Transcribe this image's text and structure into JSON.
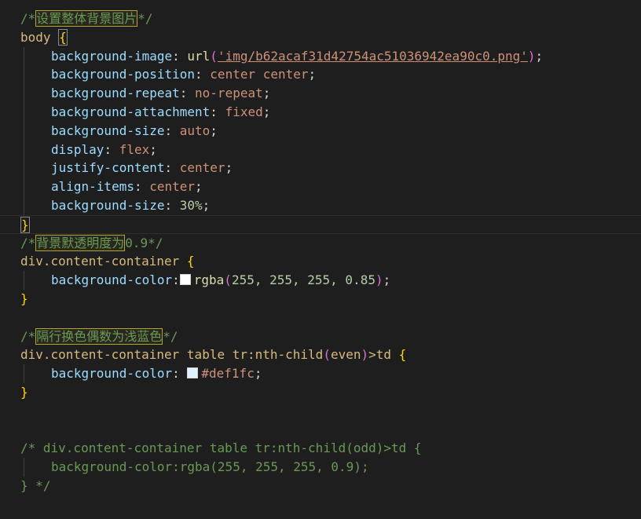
{
  "code": {
    "c1": {
      "open": "/*",
      "text": "设置整体背景图片",
      "close": "*/"
    },
    "body_sel": "body",
    "ob": "{",
    "cb": "}",
    "semi": ";",
    "colon": ": ",
    "colon_nospace": ":",
    "bg_image": {
      "prop": "background-image",
      "fn": "url",
      "lp": "(",
      "str": "'img/b62acaf31d42754ac51036942ea90c0.png'",
      "rp": ")"
    },
    "bg_position": {
      "prop": "background-position",
      "val": "center center"
    },
    "bg_repeat": {
      "prop": "background-repeat",
      "val": "no-repeat"
    },
    "bg_attach": {
      "prop": "background-attachment",
      "val": "fixed"
    },
    "bg_size1": {
      "prop": "background-size",
      "val": "auto"
    },
    "display": {
      "prop": "display",
      "val": "flex"
    },
    "justify": {
      "prop": "justify-content",
      "val": "center"
    },
    "align": {
      "prop": "align-items",
      "val": "center"
    },
    "bg_size2": {
      "prop": "background-size",
      "val": "30%"
    },
    "c2": {
      "open": "/*",
      "text": "背景默透明度为",
      "close": "0.9*/"
    },
    "sel2": "div.content-container ",
    "bgc1": {
      "prop": "background-color",
      "fn": "rgba",
      "lp": "(",
      "args": "255, 255, 255, 0.85",
      "rp": ")",
      "swatch": "#ffffff"
    },
    "c3": {
      "open": "/*",
      "text": "隔行换色偶数为浅蓝色",
      "close": "*/"
    },
    "sel3": {
      "a": "div.content-container table tr:nth-child",
      "lp": "(",
      "arg": "even",
      "rp": ")",
      "b": ">td "
    },
    "bgc2": {
      "prop": "background-color",
      "val": "#def1fc",
      "swatch": "#def1fc"
    },
    "c4a": "/* div.content-container table tr:nth-child(odd)>td {",
    "c4b": "background-color:rgba(255, 255, 255, 0.9);",
    "c4c": "} */"
  }
}
